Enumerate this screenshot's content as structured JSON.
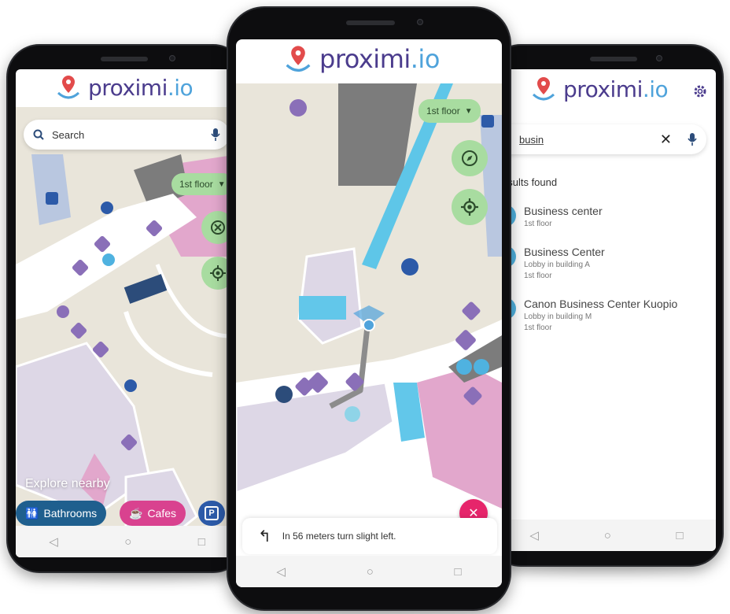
{
  "brand": {
    "name_main": "proximi",
    "name_suffix": ".io",
    "colors": {
      "brand_purple": "#4b3c8d",
      "brand_blue": "#4fa3db",
      "accent_green": "#a8dca0",
      "accent_pink": "#e6256b",
      "route_blue": "#5ec6e8"
    }
  },
  "left_phone": {
    "search": {
      "placeholder": "Search"
    },
    "floor_label": "1st floor",
    "explore_label": "Explore nearby",
    "chips": [
      {
        "label": "Bathrooms",
        "icon": "restroom-icon",
        "color": "#1f5f8e"
      },
      {
        "label": "Cafes",
        "icon": "coffee-icon",
        "color": "#d9428f"
      },
      {
        "label": "P",
        "icon": "parking-icon",
        "color": "#2c5aa8"
      }
    ]
  },
  "center_phone": {
    "floor_label": "1st floor",
    "instruction": "In 56 meters turn slight left."
  },
  "right_phone": {
    "search": {
      "value": "busin"
    },
    "results_title": "esults found",
    "results": [
      {
        "name": "Business center",
        "lines": [
          "1st floor"
        ]
      },
      {
        "name": "Business Center",
        "lines": [
          "Lobby in building A",
          "1st floor"
        ]
      },
      {
        "name": "Canon Business Center Kuopio",
        "lines": [
          "Lobby in building M",
          "1st floor"
        ]
      }
    ]
  }
}
